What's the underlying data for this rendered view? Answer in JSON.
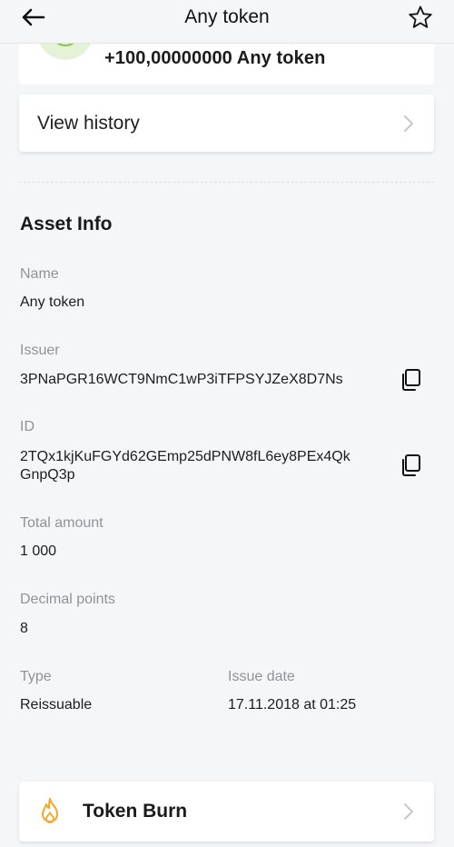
{
  "header": {
    "title": "Any token"
  },
  "transaction": {
    "amount": "+100,00000000 Any token"
  },
  "history": {
    "label": "View history"
  },
  "asset_info": {
    "section_title": "Asset Info",
    "name_label": "Name",
    "name_value": "Any token",
    "issuer_label": "Issuer",
    "issuer_value": "3PNaPGR16WCT9NmC1wP3iTFPSYJZeX8D7Ns",
    "id_label": "ID",
    "id_value_line1": "2TQx1kjKuFGYd62GEmp25dPNW8fL6ey8PEx4Qk",
    "id_value_line2": "GnpQ3p",
    "total_amount_label": "Total amount",
    "total_amount_value": "1 000",
    "decimal_points_label": "Decimal points",
    "decimal_points_value": "8",
    "type_label": "Type",
    "type_value": "Reissuable",
    "issue_date_label": "Issue date",
    "issue_date_value": "17.11.2018 at 01:25"
  },
  "token_burn": {
    "label": "Token Burn"
  },
  "icons": {
    "back": "arrow-left-icon",
    "favorite": "star-outline-icon",
    "receive": "arrow-down-circle-icon",
    "info": "info-icon",
    "chevron": "chevron-right-icon",
    "copy": "copy-icon",
    "burn": "flame-icon"
  },
  "colors": {
    "background": "#f5f6f8",
    "card": "#ffffff",
    "receive_green": "#8cc152",
    "burn_orange": "#f5a623",
    "label_gray": "#8f9399"
  }
}
